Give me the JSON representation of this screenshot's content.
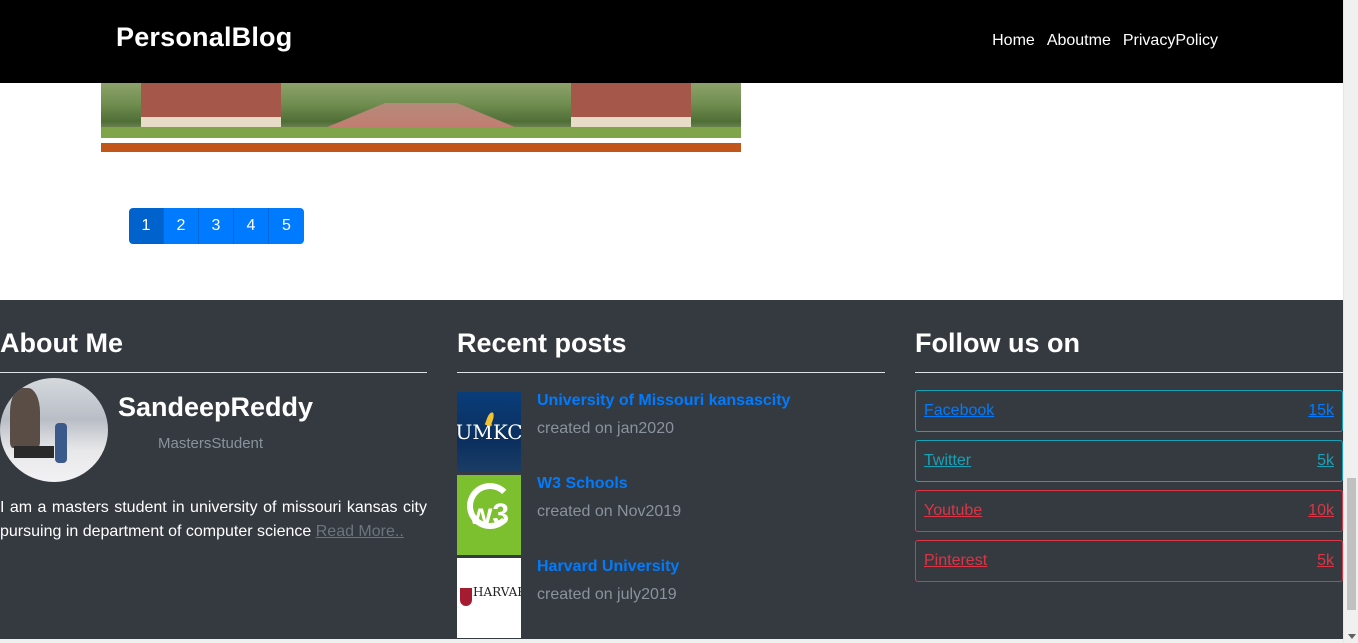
{
  "navbar": {
    "brand": "PersonalBlog",
    "links": [
      "Home",
      "Aboutme",
      "PrivacyPolicy"
    ]
  },
  "pagination": {
    "pages": [
      "1",
      "2",
      "3",
      "4",
      "5"
    ],
    "active_page": "1"
  },
  "footer": {
    "about": {
      "heading": "About Me",
      "name": "SandeepReddy",
      "role": "MastersStudent",
      "text": "I am a masters student in university of missouri kansas city pursuing in department of computer science",
      "read_more": "Read More.."
    },
    "recent": {
      "heading": "Recent posts",
      "posts": [
        {
          "title": "University of Missouri kansascity",
          "meta": "created on jan2020",
          "thumb_text": "UMKC"
        },
        {
          "title": "W3 Schools",
          "meta": "created on Nov2019",
          "thumb_text": "w3"
        },
        {
          "title": "Harvard University",
          "meta": "created on july2019",
          "thumb_text": "HARVARD"
        }
      ]
    },
    "follow": {
      "heading": "Follow us on",
      "items": [
        {
          "name": "Facebook",
          "count": "15k"
        },
        {
          "name": "Twitter",
          "count": "5k"
        },
        {
          "name": "Youtube",
          "count": "10k"
        },
        {
          "name": "Pinterest",
          "count": "5k"
        }
      ]
    }
  },
  "colors": {
    "navbar_bg": "#000000",
    "footer_bg": "#343a40",
    "primary": "#007bff",
    "info": "#17a2b8",
    "danger": "#dc3545"
  }
}
